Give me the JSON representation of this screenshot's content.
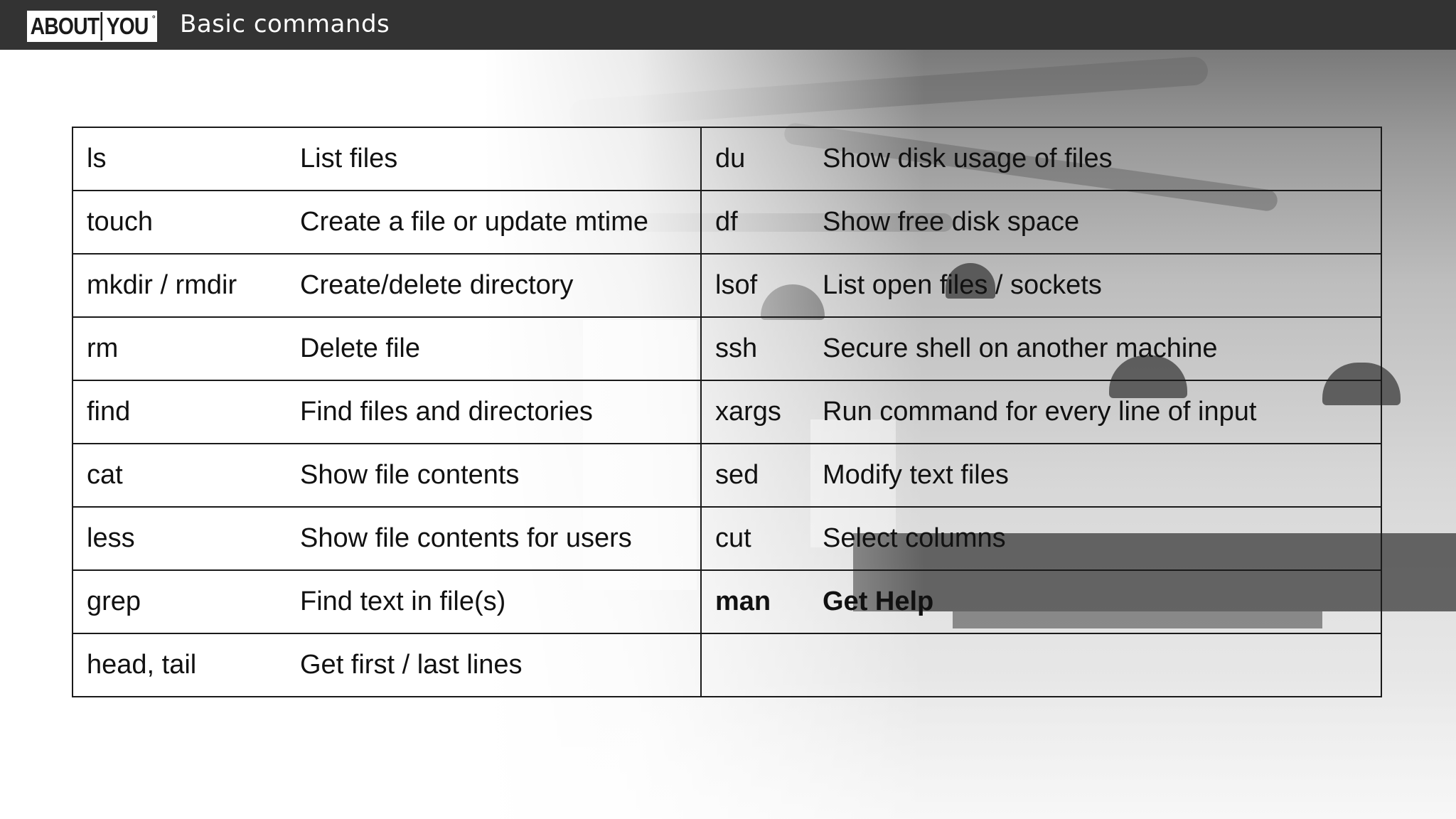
{
  "header": {
    "logo_left": "ABOUT",
    "logo_right": "YOU",
    "logo_mark": "°",
    "title": "Basic commands"
  },
  "commands": [
    {
      "left_cmd": "ls",
      "left_desc": "List files",
      "right_cmd": "du",
      "right_desc": "Show disk usage of files"
    },
    {
      "left_cmd": "touch",
      "left_desc": "Create a file or update mtime",
      "right_cmd": "df",
      "right_desc": "Show free disk space"
    },
    {
      "left_cmd": "mkdir / rmdir",
      "left_desc": "Create/delete directory",
      "right_cmd": "lsof",
      "right_desc": "List open files / sockets"
    },
    {
      "left_cmd": "rm",
      "left_desc": "Delete file",
      "right_cmd": "ssh",
      "right_desc": "Secure shell on another machine"
    },
    {
      "left_cmd": "find",
      "left_desc": "Find files and directories",
      "right_cmd": "xargs",
      "right_desc": "Run command for every line of input"
    },
    {
      "left_cmd": "cat",
      "left_desc": "Show file contents",
      "right_cmd": "sed",
      "right_desc": "Modify text files"
    },
    {
      "left_cmd": "less",
      "left_desc": "Show file contents for users",
      "right_cmd": "cut",
      "right_desc": "Select columns"
    },
    {
      "left_cmd": "grep",
      "left_desc": "Find text in file(s)",
      "right_cmd": "man",
      "right_desc": "Get Help"
    },
    {
      "left_cmd": "head, tail",
      "left_desc": "Get first / last lines",
      "right_cmd": "",
      "right_desc": ""
    }
  ],
  "colors": {
    "header_bg": "#333333",
    "text": "#111111"
  }
}
